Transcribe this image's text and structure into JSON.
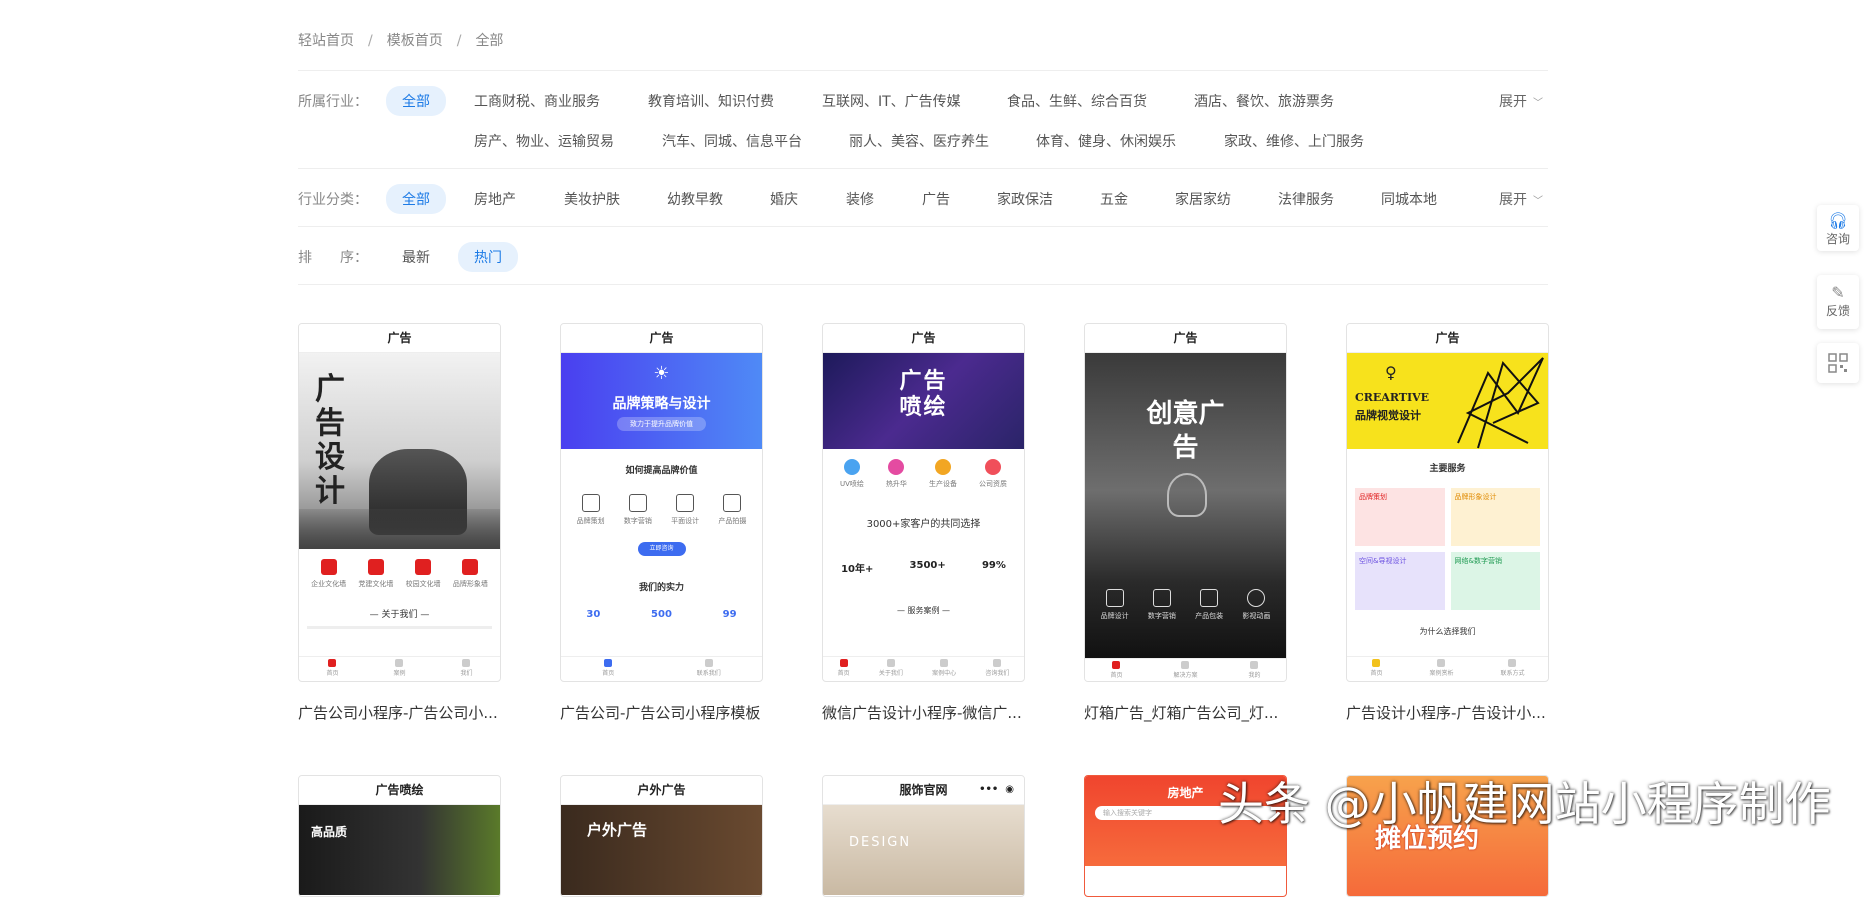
{
  "breadcrumb": [
    "轻站首页",
    "模板首页",
    "全部"
  ],
  "industry": {
    "label": "所属行业：",
    "active": "全部",
    "row1": [
      "工商财税、商业服务",
      "教育培训、知识付费",
      "互联网、IT、广告传媒",
      "食品、生鲜、综合百货",
      "酒店、餐饮、旅游票务"
    ],
    "row2": [
      "房产、物业、运输贸易",
      "汽车、同城、信息平台",
      "丽人、美容、医疗养生",
      "体育、健身、休闲娱乐",
      "家政、维修、上门服务"
    ],
    "expand": "展开"
  },
  "category": {
    "label": "行业分类：",
    "active": "全部",
    "items": [
      "房地产",
      "美妆护肤",
      "幼教早教",
      "婚庆",
      "装修",
      "广告",
      "家政保洁",
      "五金",
      "家居家纺",
      "法律服务",
      "同城本地"
    ],
    "expand": "展开"
  },
  "sort": {
    "label": "排　　序：",
    "items": [
      "最新"
    ],
    "active": "热门"
  },
  "cards": [
    {
      "head": "广告",
      "title": "广告公司小程序-广告公司小...",
      "banner_text": "广告设计",
      "icons": [
        "企业文化墙",
        "党建文化墙",
        "校园文化墙",
        "品牌形象墙"
      ],
      "section": "关于我们",
      "tabs": [
        "首页",
        "案例",
        "我们"
      ]
    },
    {
      "head": "广告",
      "title": "广告公司-广告公司小程序模板",
      "banner_text": "品牌策略与设计",
      "banner_sub": "致力于提升品牌价值",
      "section": "如何提高品牌价值",
      "icons": [
        "品牌策划",
        "数字营销",
        "平面设计",
        "产品拍摄"
      ],
      "button": "立即咨询",
      "section2": "我们的实力",
      "stats": [
        "30",
        "500",
        "99"
      ],
      "tabs": [
        "首页",
        "联系我们"
      ]
    },
    {
      "head": "广告",
      "title": "微信广告设计小程序-微信广...",
      "banner_text": "广告喷绘",
      "icons": [
        "UV喷绘",
        "热升华",
        "生产设备",
        "公司资质"
      ],
      "section": "3000+家客户的共同选择",
      "stats": [
        "10年+",
        "3500+",
        "99%"
      ],
      "section2": "服务案例",
      "tabs": [
        "首页",
        "关于我们",
        "案例中心",
        "咨询我们"
      ]
    },
    {
      "head": "广告",
      "title": "灯箱广告_灯箱广告公司_灯...",
      "banner_text": "创意广告",
      "icons": [
        "品牌设计",
        "数字营销",
        "产品包装",
        "影视动画"
      ],
      "tabs": [
        "首页",
        "解决方案",
        "我的"
      ]
    },
    {
      "head": "广告",
      "title": "广告设计小程序-广告设计小...",
      "banner_text": "CREARTIVE",
      "banner_sub": "品牌视觉设计",
      "section": "主要服务",
      "icons": [
        "品牌策划",
        "品牌形象设计",
        "空间&导视设计",
        "网络&数字营销"
      ],
      "section2": "为什么选择我们",
      "tabs": [
        "首页",
        "案例赏析",
        "联系方式"
      ]
    }
  ],
  "cards_row2": [
    {
      "head": "广告喷绘",
      "banner_text": "高品质"
    },
    {
      "head": "户外广告",
      "banner_text": "户外广告"
    },
    {
      "head": "服饰官网",
      "banner_text": "DESIGN"
    },
    {
      "head": "房地产",
      "banner_text": "输入搜索关键字"
    },
    {
      "head": "",
      "banner_text": "摊位预约"
    }
  ],
  "side": [
    {
      "label": "咨询",
      "icon": "headset-icon"
    },
    {
      "label": "反馈",
      "icon": "pencil-icon"
    },
    {
      "label": "",
      "icon": "qr-code-icon"
    }
  ],
  "watermark": "头条 @小帆建网站小程序制作",
  "colors": {
    "accent": "#1d7be6",
    "chip_bg": "#e6f1fd",
    "red": "#e02020"
  }
}
